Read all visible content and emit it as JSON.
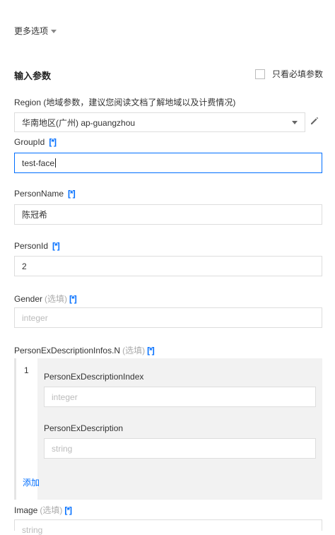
{
  "more_options": {
    "label": "更多选项"
  },
  "section": {
    "title": "输入参数",
    "required_only_label": "只看必填参数"
  },
  "required_marker": "[*]",
  "optional_marker": "(选填)",
  "region": {
    "label": "Region (地域参数，建议您阅读文档了解地域以及计费情况)",
    "value": "华南地区(广州) ap-guangzhou"
  },
  "fields": {
    "group_id": {
      "label": "GroupId",
      "value": "test-face"
    },
    "person_name": {
      "label": "PersonName",
      "value": "陈冠希"
    },
    "person_id": {
      "label": "PersonId",
      "value": "2"
    },
    "gender": {
      "label": "Gender",
      "placeholder": "integer"
    },
    "person_ex_desc": {
      "label": "PersonExDescriptionInfos.N",
      "index": "1",
      "sub_fields": {
        "index_field": {
          "label": "PersonExDescriptionIndex",
          "placeholder": "integer"
        },
        "desc_field": {
          "label": "PersonExDescription",
          "placeholder": "string"
        }
      },
      "add_label": "添加"
    },
    "image": {
      "label": "Image",
      "placeholder": "string"
    }
  }
}
